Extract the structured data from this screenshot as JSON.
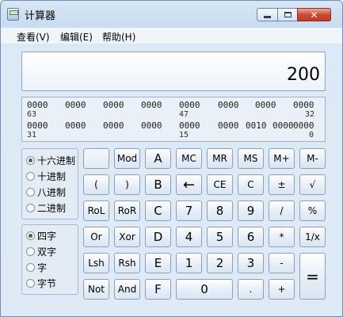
{
  "window": {
    "title": "计算器",
    "min_label": "",
    "max_label": "",
    "close_label": "✕"
  },
  "menu": [
    "查看(V)",
    "编辑(E)",
    "帮助(H)"
  ],
  "display": {
    "value": "200"
  },
  "bits": {
    "row1": [
      "0000",
      "0000",
      "0000",
      "0000",
      "0000",
      "0000",
      "0000",
      "0000"
    ],
    "row1_idx": [
      "63",
      "47",
      "32"
    ],
    "row2": [
      "0000",
      "0000",
      "0000",
      "0000",
      "0000",
      "0000",
      "0010",
      "0000",
      "0000"
    ],
    "row2_idx": [
      "31",
      "15",
      "0"
    ]
  },
  "base_options": [
    {
      "label": "十六进制",
      "selected": true
    },
    {
      "label": "十进制",
      "selected": false
    },
    {
      "label": "八进制",
      "selected": false
    },
    {
      "label": "二进制",
      "selected": false
    }
  ],
  "word_options": [
    {
      "label": "四字",
      "selected": true
    },
    {
      "label": "双字",
      "selected": false
    },
    {
      "label": "字",
      "selected": false
    },
    {
      "label": "字节",
      "selected": false
    }
  ],
  "keys": {
    "r1": [
      "",
      "Mod",
      "A",
      "MC",
      "MR",
      "MS",
      "M+",
      "M-"
    ],
    "r2": [
      "(",
      ")",
      "B",
      "←",
      "CE",
      "C",
      "±",
      "√"
    ],
    "r3": [
      "RoL",
      "RoR",
      "C",
      "7",
      "8",
      "9",
      "/",
      "%"
    ],
    "r4": [
      "Or",
      "Xor",
      "D",
      "4",
      "5",
      "6",
      "*",
      "1/x"
    ],
    "r5": [
      "Lsh",
      "Rsh",
      "E",
      "1",
      "2",
      "3",
      "-"
    ],
    "r6": [
      "Not",
      "And",
      "F",
      "0",
      ".",
      "+"
    ],
    "equals": "="
  }
}
